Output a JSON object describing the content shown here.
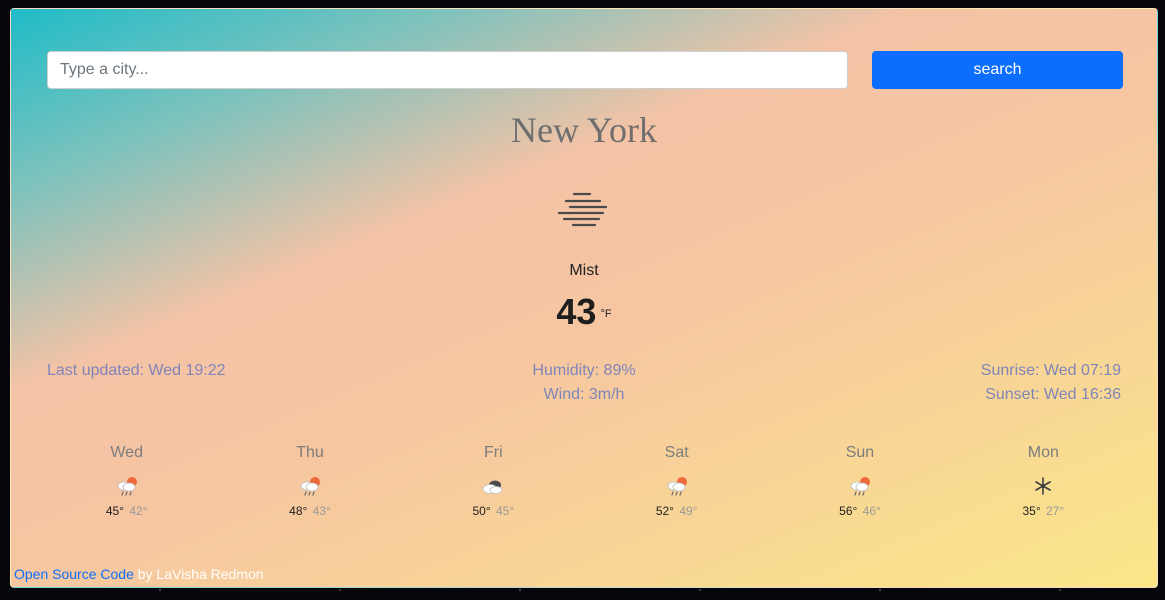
{
  "search": {
    "placeholder": "Type a city...",
    "value": "",
    "button_label": "search"
  },
  "current": {
    "city": "New York",
    "icon": "mist-icon",
    "description": "Mist",
    "temperature": "43",
    "unit": "°F"
  },
  "details": {
    "last_updated": "Last updated: Wed 19:22",
    "humidity": "Humidity: 89%",
    "wind": "Wind: 3m/h",
    "sunrise": "Sunrise: Wed 07:19",
    "sunset": "Sunset: Wed 16:36"
  },
  "forecast": [
    {
      "day": "Wed",
      "icon": "rain-snow-icon",
      "high": "45°",
      "low": "42°"
    },
    {
      "day": "Thu",
      "icon": "rain-snow-icon",
      "high": "48°",
      "low": "43°"
    },
    {
      "day": "Fri",
      "icon": "cloudy-icon",
      "high": "50°",
      "low": "45°"
    },
    {
      "day": "Sat",
      "icon": "rain-snow-icon",
      "high": "52°",
      "low": "49°"
    },
    {
      "day": "Sun",
      "icon": "rain-snow-icon",
      "high": "56°",
      "low": "46°"
    },
    {
      "day": "Mon",
      "icon": "snow-icon",
      "high": "35°",
      "low": "27°"
    }
  ],
  "footer": {
    "link_text": "Open Source Code",
    "byline": " by LaVisha Redmon"
  },
  "colors": {
    "accent": "#0d6efd",
    "info_text": "#7f85b9",
    "city_text": "#6e6e6e"
  }
}
